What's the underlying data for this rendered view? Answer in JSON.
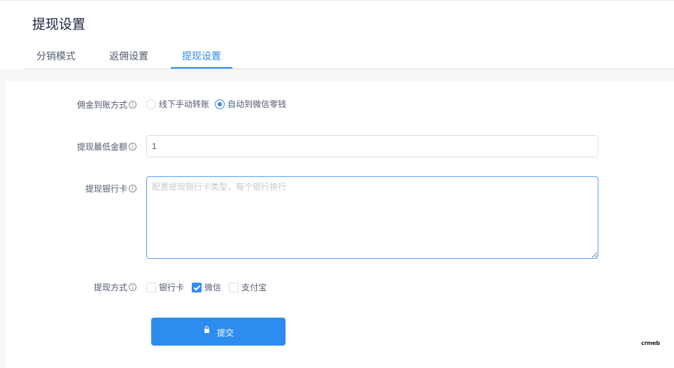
{
  "page": {
    "title": "提现设置"
  },
  "tabs": [
    {
      "label": "分销模式"
    },
    {
      "label": "返佣设置"
    },
    {
      "label": "提现设置",
      "active": true
    }
  ],
  "form": {
    "commission_method": {
      "label": "佣金到账方式",
      "options": [
        {
          "label": "线下手动转账",
          "selected": false
        },
        {
          "label": "自动到微信零钱",
          "selected": true
        }
      ]
    },
    "min_amount": {
      "label": "提现最低金额",
      "value": "1"
    },
    "bank_cards": {
      "label": "提现银行卡",
      "placeholder": "配置提现银行卡类型，每个银行换行"
    },
    "withdraw_methods": {
      "label": "提现方式",
      "options": [
        {
          "label": "银行卡",
          "checked": false
        },
        {
          "label": "微信",
          "checked": true
        },
        {
          "label": "支付宝",
          "checked": false
        }
      ]
    },
    "info_glyph": "i",
    "submit_label": "提交"
  },
  "branding": {
    "text": "crmeb"
  },
  "colors": {
    "accent": "#2d8cf0",
    "text": "#515a6e",
    "background": "#f5f7f9"
  }
}
